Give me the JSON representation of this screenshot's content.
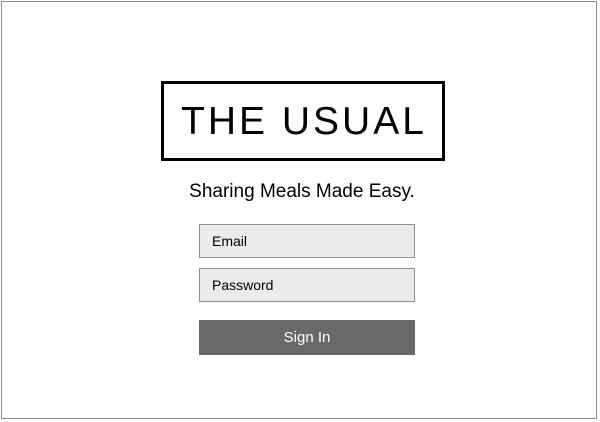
{
  "brand": {
    "logo_text": "THE USUAL",
    "tagline": "Sharing Meals Made Easy."
  },
  "login_form": {
    "email_placeholder": "Email",
    "password_placeholder": "Password",
    "submit_label": "Sign In"
  },
  "colors": {
    "input_background": "#ebebeb",
    "input_border": "#8f8f8f",
    "button_background": "#696969",
    "button_text": "#ffffff",
    "logo_border": "#000000"
  }
}
